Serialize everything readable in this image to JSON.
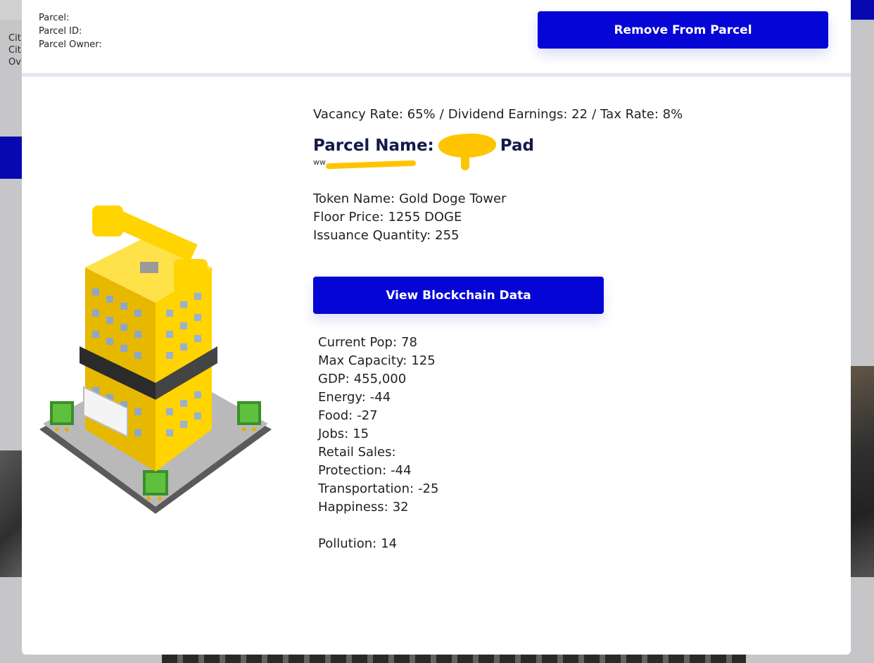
{
  "background": {
    "left_info": [
      "Cit",
      "Cit",
      "Ov"
    ]
  },
  "modal": {
    "header": {
      "parcel_label": "Parcel:",
      "parcel_value": "",
      "parcel_id_label": "Parcel ID:",
      "parcel_id_value": "",
      "parcel_owner_label": "Parcel Owner:",
      "parcel_owner_value": "",
      "remove_button": "Remove From Parcel"
    },
    "summary": {
      "vacancy": "Vacancy Rate: 65%",
      "sep1": "/",
      "dividend": "Dividend Earnings: 22",
      "sep2": "/",
      "tax": "Tax Rate: 8%"
    },
    "parcel_name": {
      "label": "Parcel Name:",
      "value_suffix": "Pad",
      "website_prefix": "ww"
    },
    "token": {
      "name_label": "Token Name:",
      "name_value": "Gold Doge Tower",
      "floor_label": "Floor Price:",
      "floor_value": "1255 DOGE",
      "issuance_label": "Issuance Quantity:",
      "issuance_value": "255"
    },
    "blockchain_button": "View Blockchain Data",
    "stats": [
      {
        "label": "Current Pop:",
        "value": "78"
      },
      {
        "label": "Max Capacity:",
        "value": "125"
      },
      {
        "label": "GDP:",
        "value": "455,000"
      },
      {
        "label": "Energy:",
        "value": "-44"
      },
      {
        "label": "Food:",
        "value": "-27"
      },
      {
        "label": "Jobs:",
        "value": "15"
      },
      {
        "label": "Retail Sales:",
        "value": ""
      },
      {
        "label": "Protection:",
        "value": "-44"
      },
      {
        "label": "Transportation:",
        "value": "-25"
      },
      {
        "label": "Happiness:",
        "value": "32"
      }
    ],
    "pollution": {
      "label": "Pollution:",
      "value": "14"
    }
  },
  "colors": {
    "primary_button": "#0505d6",
    "building_gold": "#ffd400",
    "redaction": "#ffc400"
  },
  "icons": {
    "building": "gold-doge-tower-building-icon"
  }
}
